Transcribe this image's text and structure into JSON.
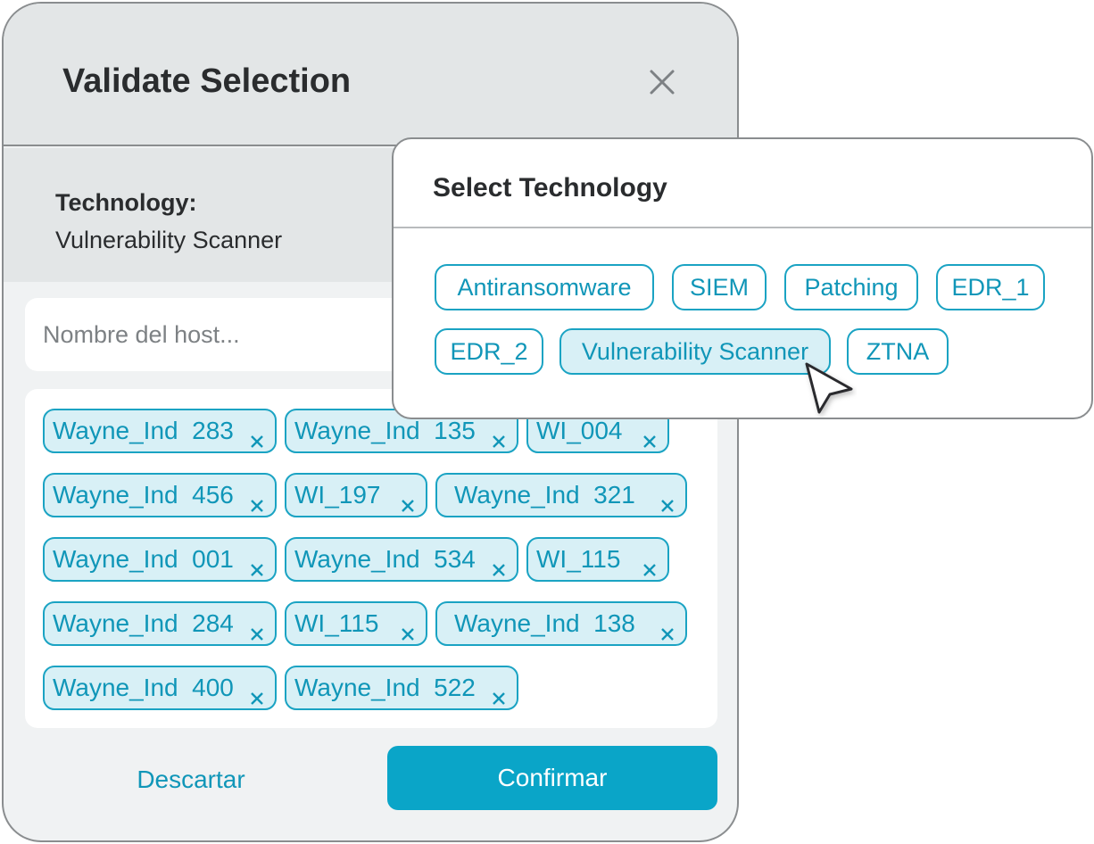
{
  "modal": {
    "title": "Validate Selection",
    "technology_label": "Technology:",
    "technology_value": "Vulnerability Scanner",
    "search_placeholder": "Nombre del host...",
    "hosts": [
      "Wayne_Ind  283",
      "Wayne_Ind  135",
      "WI_004",
      "Wayne_Ind  456",
      "WI_197",
      "Wayne_Ind  321",
      "Wayne_Ind  001",
      "Wayne_Ind  534",
      "WI_115",
      "Wayne_Ind  284",
      "WI_115",
      "Wayne_Ind  138",
      "Wayne_Ind  400",
      "Wayne_Ind  522"
    ],
    "remove_glyph": "×",
    "discard_label": "Descartar",
    "confirm_label": "Confirmar"
  },
  "popover": {
    "title": "Select Technology",
    "options": [
      "Antiransomware",
      "SIEM",
      "Patching",
      "EDR_1",
      "EDR_2",
      "Vulnerability Scanner",
      "ZTNA"
    ],
    "selected": "Vulnerability Scanner"
  },
  "colors": {
    "accent": "#0aa5c8",
    "chip_bg": "#d8f0f6",
    "chip_border": "#1aa3c3",
    "text": "#2a2c2e",
    "header_bg": "#e3e6e7",
    "modal_bg": "#f0f2f3"
  },
  "icons": {
    "close": "close-icon",
    "remove": "close-small-icon",
    "cursor": "mouse-pointer-icon"
  }
}
